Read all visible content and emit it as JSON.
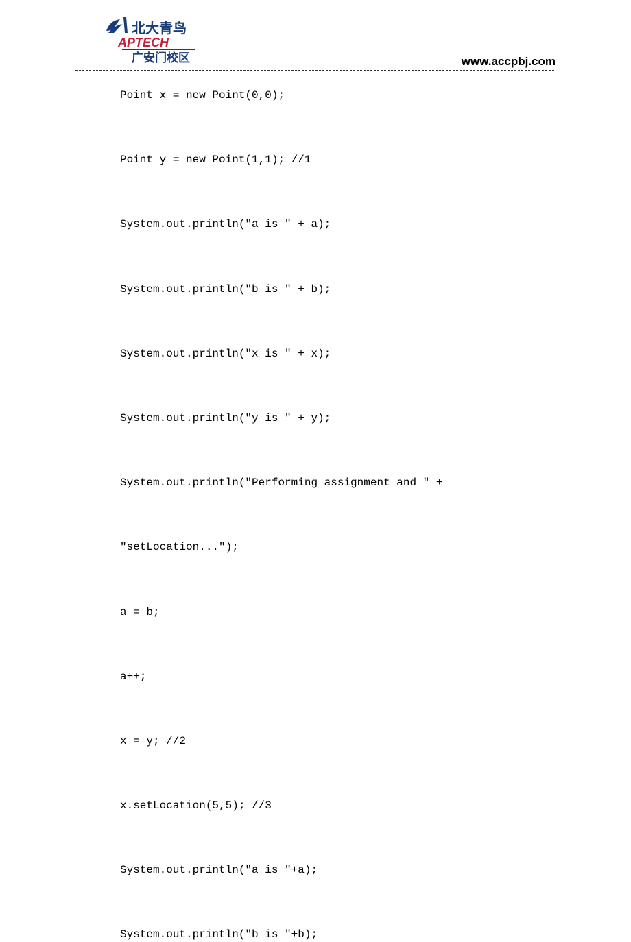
{
  "header": {
    "logo": {
      "chinese_top": "北大青鸟",
      "brand": "APTECH",
      "chinese_bottom": "广安门校区"
    },
    "url": "www.accpbj.com"
  },
  "code": {
    "lines": [
      "Point x = new Point(0,0);",
      "Point y = new Point(1,1); //1",
      "System.out.println(\"a is \" + a);",
      "System.out.println(\"b is \" + b);",
      "System.out.println(\"x is \" + x);",
      "System.out.println(\"y is \" + y);",
      "System.out.println(\"Performing assignment and \" +",
      "\"setLocation...\");",
      "a = b;",
      "a++;",
      "x = y; //2",
      "x.setLocation(5,5); //3",
      "System.out.println(\"a is \"+a);",
      "System.out.println(\"b is \"+b);"
    ]
  }
}
